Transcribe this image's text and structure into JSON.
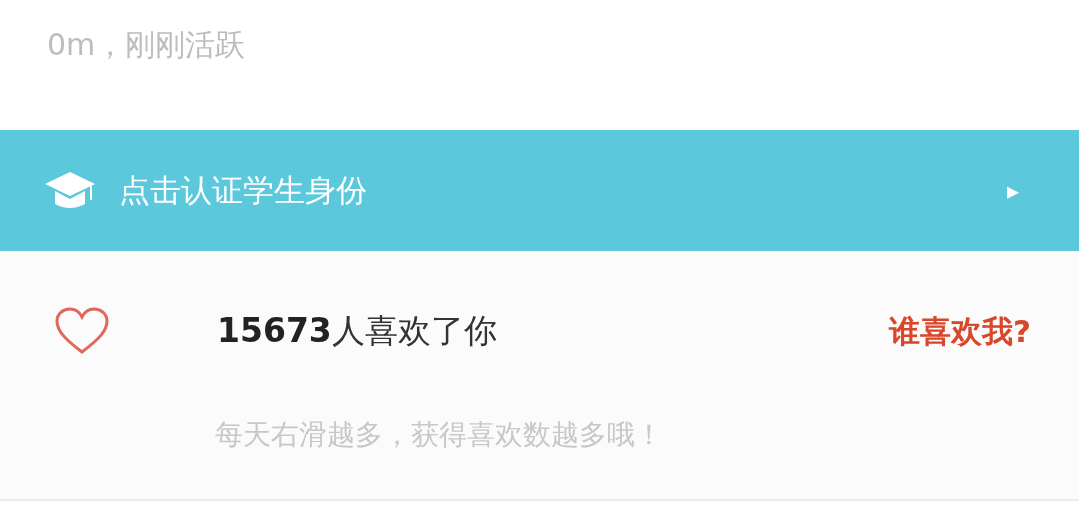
{
  "status_line": "0m，刚刚活跃",
  "verify_banner": {
    "label": "点击认证学生身份",
    "arrow": "▸"
  },
  "likes": {
    "count_text": "**15673**人喜欢了你",
    "link": "谁喜欢我?",
    "hint": "每天右滑越多，获得喜欢数越多哦！"
  }
}
